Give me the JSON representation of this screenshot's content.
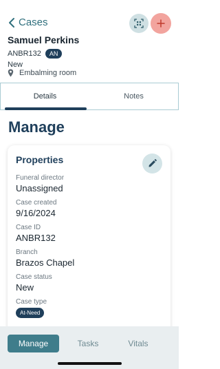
{
  "header": {
    "back_label": "Cases",
    "name": "Samuel Perkins",
    "case_id": "ANBR132",
    "badge": "AN",
    "status": "New",
    "location": "Embalming room"
  },
  "tabs": [
    {
      "label": "Details"
    },
    {
      "label": "Notes"
    }
  ],
  "section_title": "Manage",
  "properties": {
    "title": "Properties",
    "fields": [
      {
        "label": "Funeral director",
        "value": "Unassigned"
      },
      {
        "label": "Case created",
        "value": "9/16/2024"
      },
      {
        "label": "Case ID",
        "value": "ANBR132"
      },
      {
        "label": "Branch",
        "value": "Brazos Chapel"
      },
      {
        "label": "Case status",
        "value": "New"
      }
    ],
    "case_type_label": "Case type",
    "case_type_value": "At-Need"
  },
  "bottom_nav": [
    {
      "label": "Manage"
    },
    {
      "label": "Tasks"
    },
    {
      "label": "Vitals"
    }
  ],
  "colors": {
    "primary": "#1f3f5b",
    "accent_teal": "#3f7d8b",
    "add_button": "#f2a49e"
  },
  "icons": [
    "chevron-left-icon",
    "qr-scan-icon",
    "plus-icon",
    "location-pin-icon",
    "pencil-icon"
  ]
}
